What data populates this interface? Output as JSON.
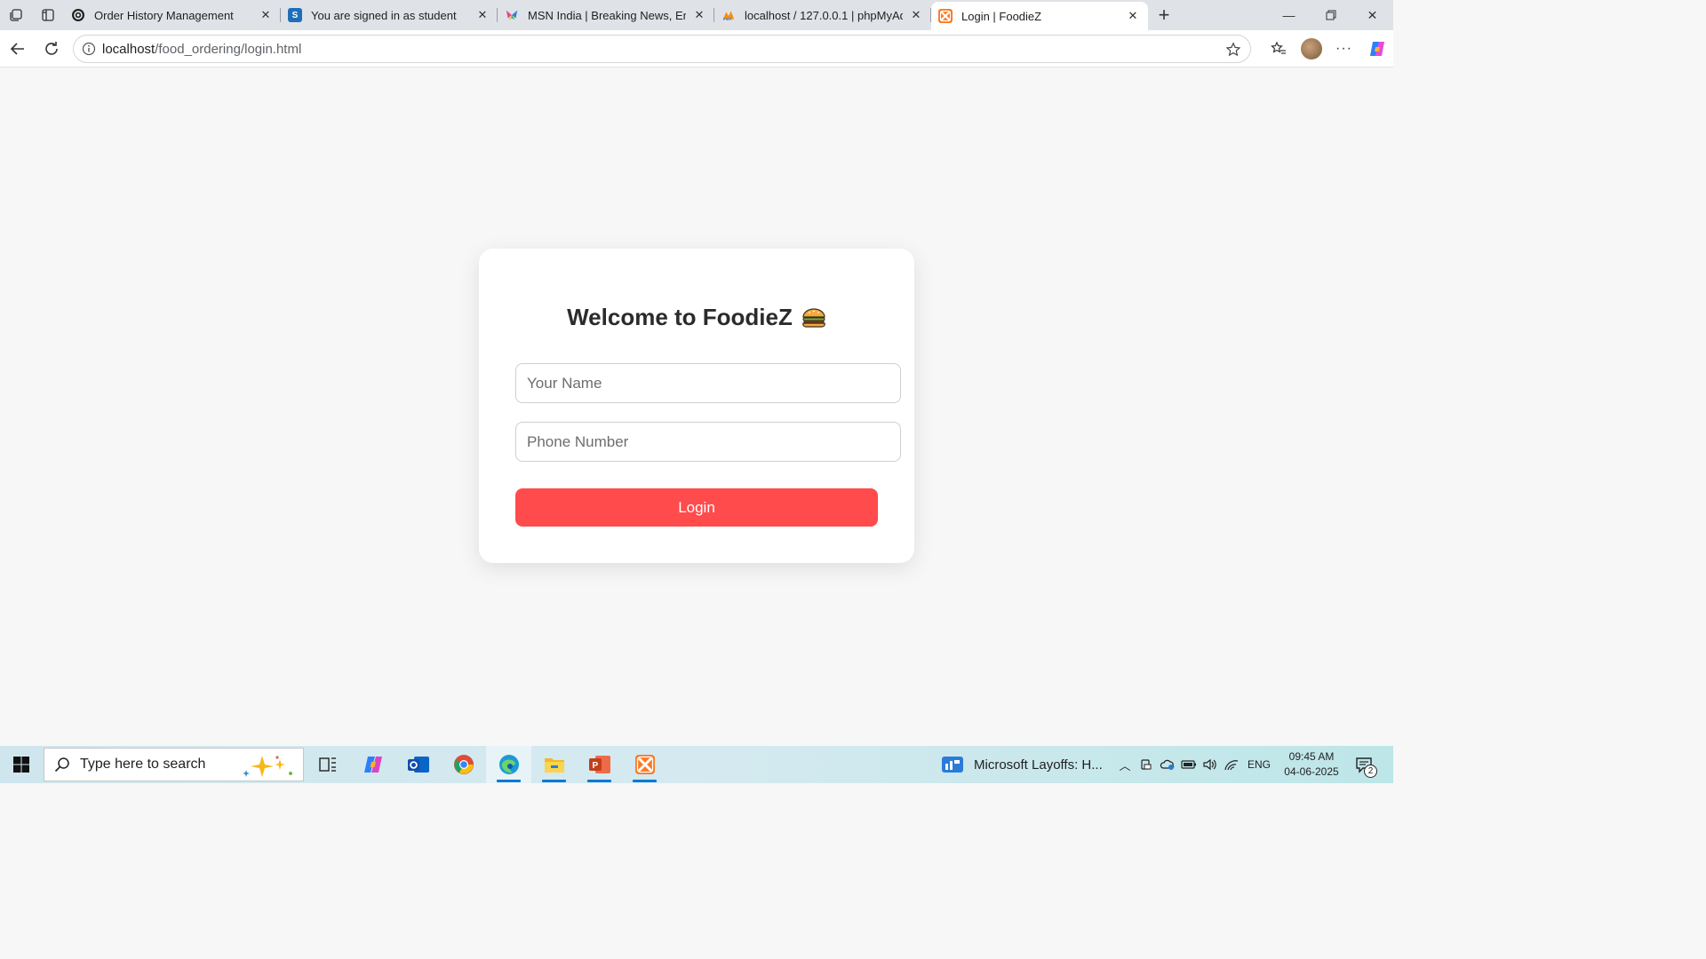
{
  "browser": {
    "tabs": [
      {
        "title": "Order History Management",
        "favicon": "openai-icon",
        "active": false
      },
      {
        "title": "You are signed in as student",
        "favicon": "s-icon",
        "active": false
      },
      {
        "title": "MSN India | Breaking News, Enter",
        "favicon": "msn-butterfly-icon",
        "active": false
      },
      {
        "title": "localhost / 127.0.0.1 | phpMyAdm",
        "favicon": "phpmyadmin-icon",
        "active": false
      },
      {
        "title": "Login | FoodieZ",
        "favicon": "xampp-icon",
        "active": true
      }
    ],
    "address": {
      "host": "localhost",
      "path": "/food_ordering/login.html"
    }
  },
  "page": {
    "title": "Welcome to FoodieZ",
    "title_emoji": "burger-icon",
    "name_placeholder": "Your Name",
    "phone_placeholder": "Phone Number",
    "login_label": "Login",
    "accent_color": "#ff4b4b"
  },
  "taskbar": {
    "search_placeholder": "Type here to search",
    "news_text": "Microsoft Layoffs: H...",
    "language": "ENG",
    "time": "09:45 AM",
    "date": "04-06-2025",
    "notification_count": "2"
  }
}
